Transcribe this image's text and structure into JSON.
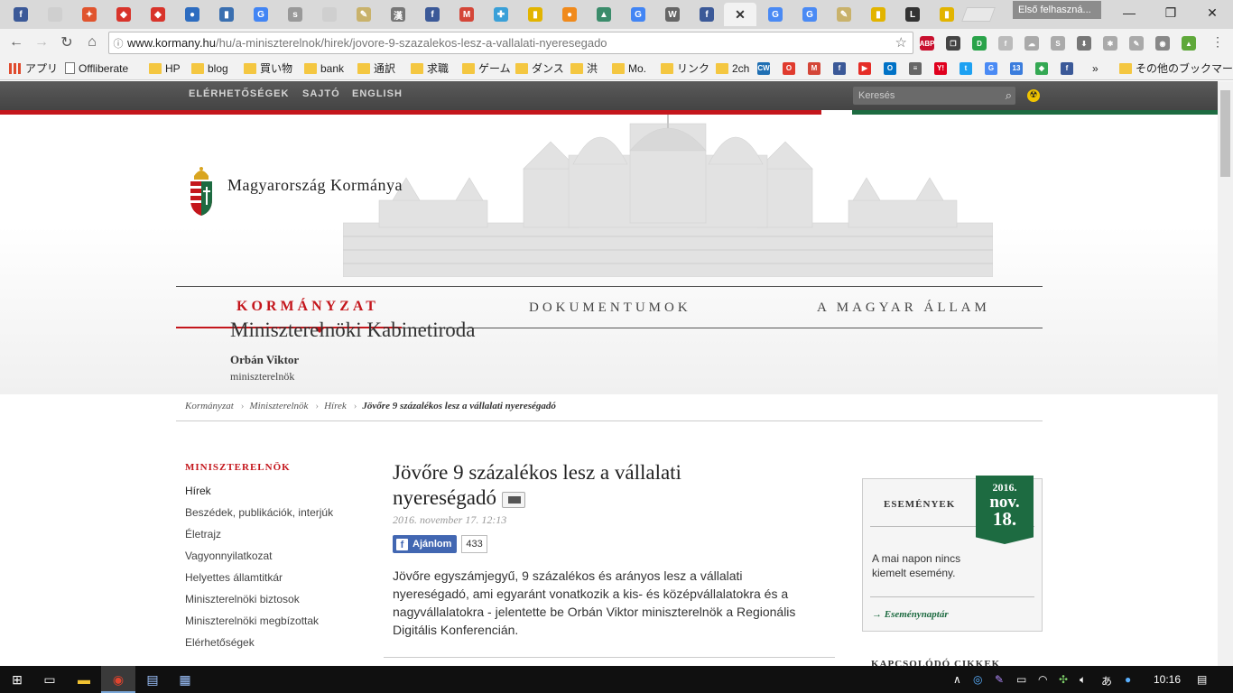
{
  "browser": {
    "tabs": [
      {
        "icon": "facebook-icon",
        "glyph": "f",
        "color": "#3b5998"
      },
      {
        "icon": "page-icon",
        "glyph": "",
        "color": "#cfcfcf"
      },
      {
        "icon": "running-figure-icon",
        "glyph": "✦",
        "color": "#e0542e"
      },
      {
        "icon": "red-logo-icon",
        "glyph": "◆",
        "color": "#d8342b"
      },
      {
        "icon": "red-logo-icon",
        "glyph": "◆",
        "color": "#d8342b"
      },
      {
        "icon": "globe-icon",
        "glyph": "●",
        "color": "#2d6cc0"
      },
      {
        "icon": "bookmark-icon",
        "glyph": "▮",
        "color": "#3a6fb0"
      },
      {
        "icon": "google-icon",
        "glyph": "G",
        "color": "#4285f4"
      },
      {
        "icon": "slix-icon",
        "glyph": "s",
        "color": "#999999"
      },
      {
        "icon": "page-icon",
        "glyph": "",
        "color": "#cfcfcf"
      },
      {
        "icon": "note-icon",
        "glyph": "✎",
        "color": "#c9b26b"
      },
      {
        "icon": "kanji-icon",
        "glyph": "漢",
        "color": "#777777"
      },
      {
        "icon": "facebook-icon",
        "glyph": "f",
        "color": "#3b5998"
      },
      {
        "icon": "gmail-icon",
        "glyph": "M",
        "color": "#d44638"
      },
      {
        "icon": "figure-icon",
        "glyph": "✚",
        "color": "#3aa0d8"
      },
      {
        "icon": "yellow-bar-icon",
        "glyph": "▮",
        "color": "#e2b400"
      },
      {
        "icon": "orange-circle-icon",
        "glyph": "●",
        "color": "#f08a1c"
      },
      {
        "icon": "green-stack-icon",
        "glyph": "▲",
        "color": "#3b8c6b"
      },
      {
        "icon": "google-icon",
        "glyph": "G",
        "color": "#4285f4"
      },
      {
        "icon": "wikipedia-icon",
        "glyph": "W",
        "color": "#666666"
      },
      {
        "icon": "facebook-icon",
        "glyph": "f",
        "color": "#3b5998"
      },
      {
        "icon": "close-icon",
        "glyph": "✕",
        "color": "#333333"
      },
      {
        "icon": "translate-icon",
        "glyph": "G",
        "color": "#4a8af4"
      },
      {
        "icon": "translate-icon",
        "glyph": "G",
        "color": "#4a8af4"
      },
      {
        "icon": "note-icon",
        "glyph": "✎",
        "color": "#c9b26b"
      },
      {
        "icon": "yellow-bar-icon",
        "glyph": "▮",
        "color": "#e2b400"
      },
      {
        "icon": "l-icon",
        "glyph": "L",
        "color": "#333333"
      },
      {
        "icon": "yellow-bar-icon",
        "glyph": "▮",
        "color": "#e2b400"
      }
    ],
    "profile_label": "Első felhaszná...",
    "address": {
      "host": "www.kormany.hu",
      "path": "/hu/a-miniszterelnok/hirek/jovore-9-szazalekos-lesz-a-vallalati-nyeresegado"
    },
    "extensions": [
      {
        "icon": "adblock-icon",
        "glyph": "ABP",
        "color": "#c8102e"
      },
      {
        "icon": "copy-icon",
        "glyph": "❐",
        "color": "#444444"
      },
      {
        "icon": "idm-icon",
        "glyph": "D",
        "color": "#2aa34a"
      },
      {
        "icon": "font-icon",
        "glyph": "f",
        "color": "#bbbbbb"
      },
      {
        "icon": "cloud-icon",
        "glyph": "☁",
        "color": "#aaaaaa"
      },
      {
        "icon": "skype-icon",
        "glyph": "S",
        "color": "#aaaaaa"
      },
      {
        "icon": "download-icon",
        "glyph": "⬇",
        "color": "#777777"
      },
      {
        "icon": "puzzle-icon",
        "glyph": "✱",
        "color": "#aaaaaa"
      },
      {
        "icon": "edit-icon",
        "glyph": "✎",
        "color": "#aaaaaa"
      },
      {
        "icon": "camera-icon",
        "glyph": "◉",
        "color": "#888888"
      },
      {
        "icon": "upload-icon",
        "glyph": "▲",
        "color": "#5fa83a"
      }
    ],
    "bookmarks": [
      {
        "label": "アプリ",
        "type": "apps"
      },
      {
        "label": "Offliberate",
        "type": "page"
      },
      {
        "label": "HP",
        "type": "folder"
      },
      {
        "label": "blog",
        "type": "folder"
      },
      {
        "label": "買い物",
        "type": "folder"
      },
      {
        "label": "bank",
        "type": "folder"
      },
      {
        "label": "通訳",
        "type": "folder"
      },
      {
        "label": "求職",
        "type": "folder"
      },
      {
        "label": "ゲーム",
        "type": "folder"
      },
      {
        "label": "ダンス",
        "type": "folder"
      },
      {
        "label": "洪",
        "type": "folder"
      },
      {
        "label": "Mo.",
        "type": "folder"
      },
      {
        "label": "リンク",
        "type": "folder"
      },
      {
        "label": "2ch",
        "type": "folder"
      }
    ],
    "bookmark_icons": [
      {
        "icon": "cw-icon",
        "glyph": "CW",
        "color": "#1f6fb3"
      },
      {
        "icon": "ring-icon",
        "glyph": "O",
        "color": "#e03b2e"
      },
      {
        "icon": "gmail-icon",
        "glyph": "M",
        "color": "#d44638"
      },
      {
        "icon": "facebook-icon",
        "glyph": "f",
        "color": "#3b5998"
      },
      {
        "icon": "youtube-icon",
        "glyph": "▶",
        "color": "#e52d27"
      },
      {
        "icon": "outlook-icon",
        "glyph": "O",
        "color": "#0072c6"
      },
      {
        "icon": "news-icon",
        "glyph": "≡",
        "color": "#666666"
      },
      {
        "icon": "yahoo-icon",
        "glyph": "Y!",
        "color": "#e0001e"
      },
      {
        "icon": "twitter-icon",
        "glyph": "t",
        "color": "#1da1f2"
      },
      {
        "icon": "translate-icon",
        "glyph": "G",
        "color": "#4a8af4"
      },
      {
        "icon": "calendar-icon",
        "glyph": "13",
        "color": "#3b7ddd"
      },
      {
        "icon": "maps-icon",
        "glyph": "◆",
        "color": "#34a853"
      },
      {
        "icon": "facebook-icon",
        "glyph": "f",
        "color": "#3b5998"
      }
    ],
    "more_bookmarks": "»",
    "other_bookmarks": "その他のブックマーク"
  },
  "site": {
    "utility_links": [
      "ELÉRHETŐSÉGEK",
      "SAJTÓ",
      "ENGLISH"
    ],
    "search_placeholder": "Keresés",
    "brand": "Magyarország Kormánya",
    "main_nav": [
      {
        "label": "KORMÁNYZAT",
        "active": true
      },
      {
        "label": "DOKUMENTUMOK",
        "active": false
      },
      {
        "label": "A MAGYAR ÁLLAM",
        "active": false
      }
    ],
    "office_title": "Miniszterelnöki Kabinetiroda",
    "pm_name": "Orbán Viktor",
    "pm_role": "miniszterelnök",
    "breadcrumb": [
      "Kormányzat",
      "Miniszterelnök",
      "Hírek"
    ],
    "breadcrumb_current": "Jövőre 9 százalékos lesz a vállalati nyereségadó",
    "sidebar": {
      "title": "MINISZTERELNÖK",
      "items": [
        "Hírek",
        "Beszédek, publikációk, interjúk",
        "Életrajz",
        "Vagyonnyilatkozat",
        "Helyettes államtitkár",
        "Miniszterelnöki biztosok",
        "Miniszterelnöki megbízottak",
        "Elérhetőségek"
      ]
    },
    "article": {
      "title": "Jövőre 9 százalékos lesz a vállalati nyereségadó",
      "date": "2016. november 17. 12:13",
      "like_label": "Ajánlom",
      "like_count": "433",
      "lead": "Jövőre egyszámjegyű, 9 százalékos és arányos lesz a vállalati nyereségadó, ami egyaránt vonatkozik a kis- és középvállalatokra és a nagyvállalatokra - jelentette be Orbán Viktor miniszterelnök a Regionális Digitális Konferencián."
    },
    "events": {
      "title": "ESEMÉNYEK",
      "date_year": "2016.",
      "date_month": "nov.",
      "date_day": "18.",
      "empty_text": "A mai napon nincs kiemelt esemény.",
      "calendar_link": "Eseménynaptár"
    },
    "related_title": "KAPCSOLÓDÓ CIKKEK",
    "colors": {
      "red": "#c4161c",
      "green": "#1d6b41"
    }
  },
  "taskbar": {
    "clock": "10:16",
    "ime": "あ"
  }
}
